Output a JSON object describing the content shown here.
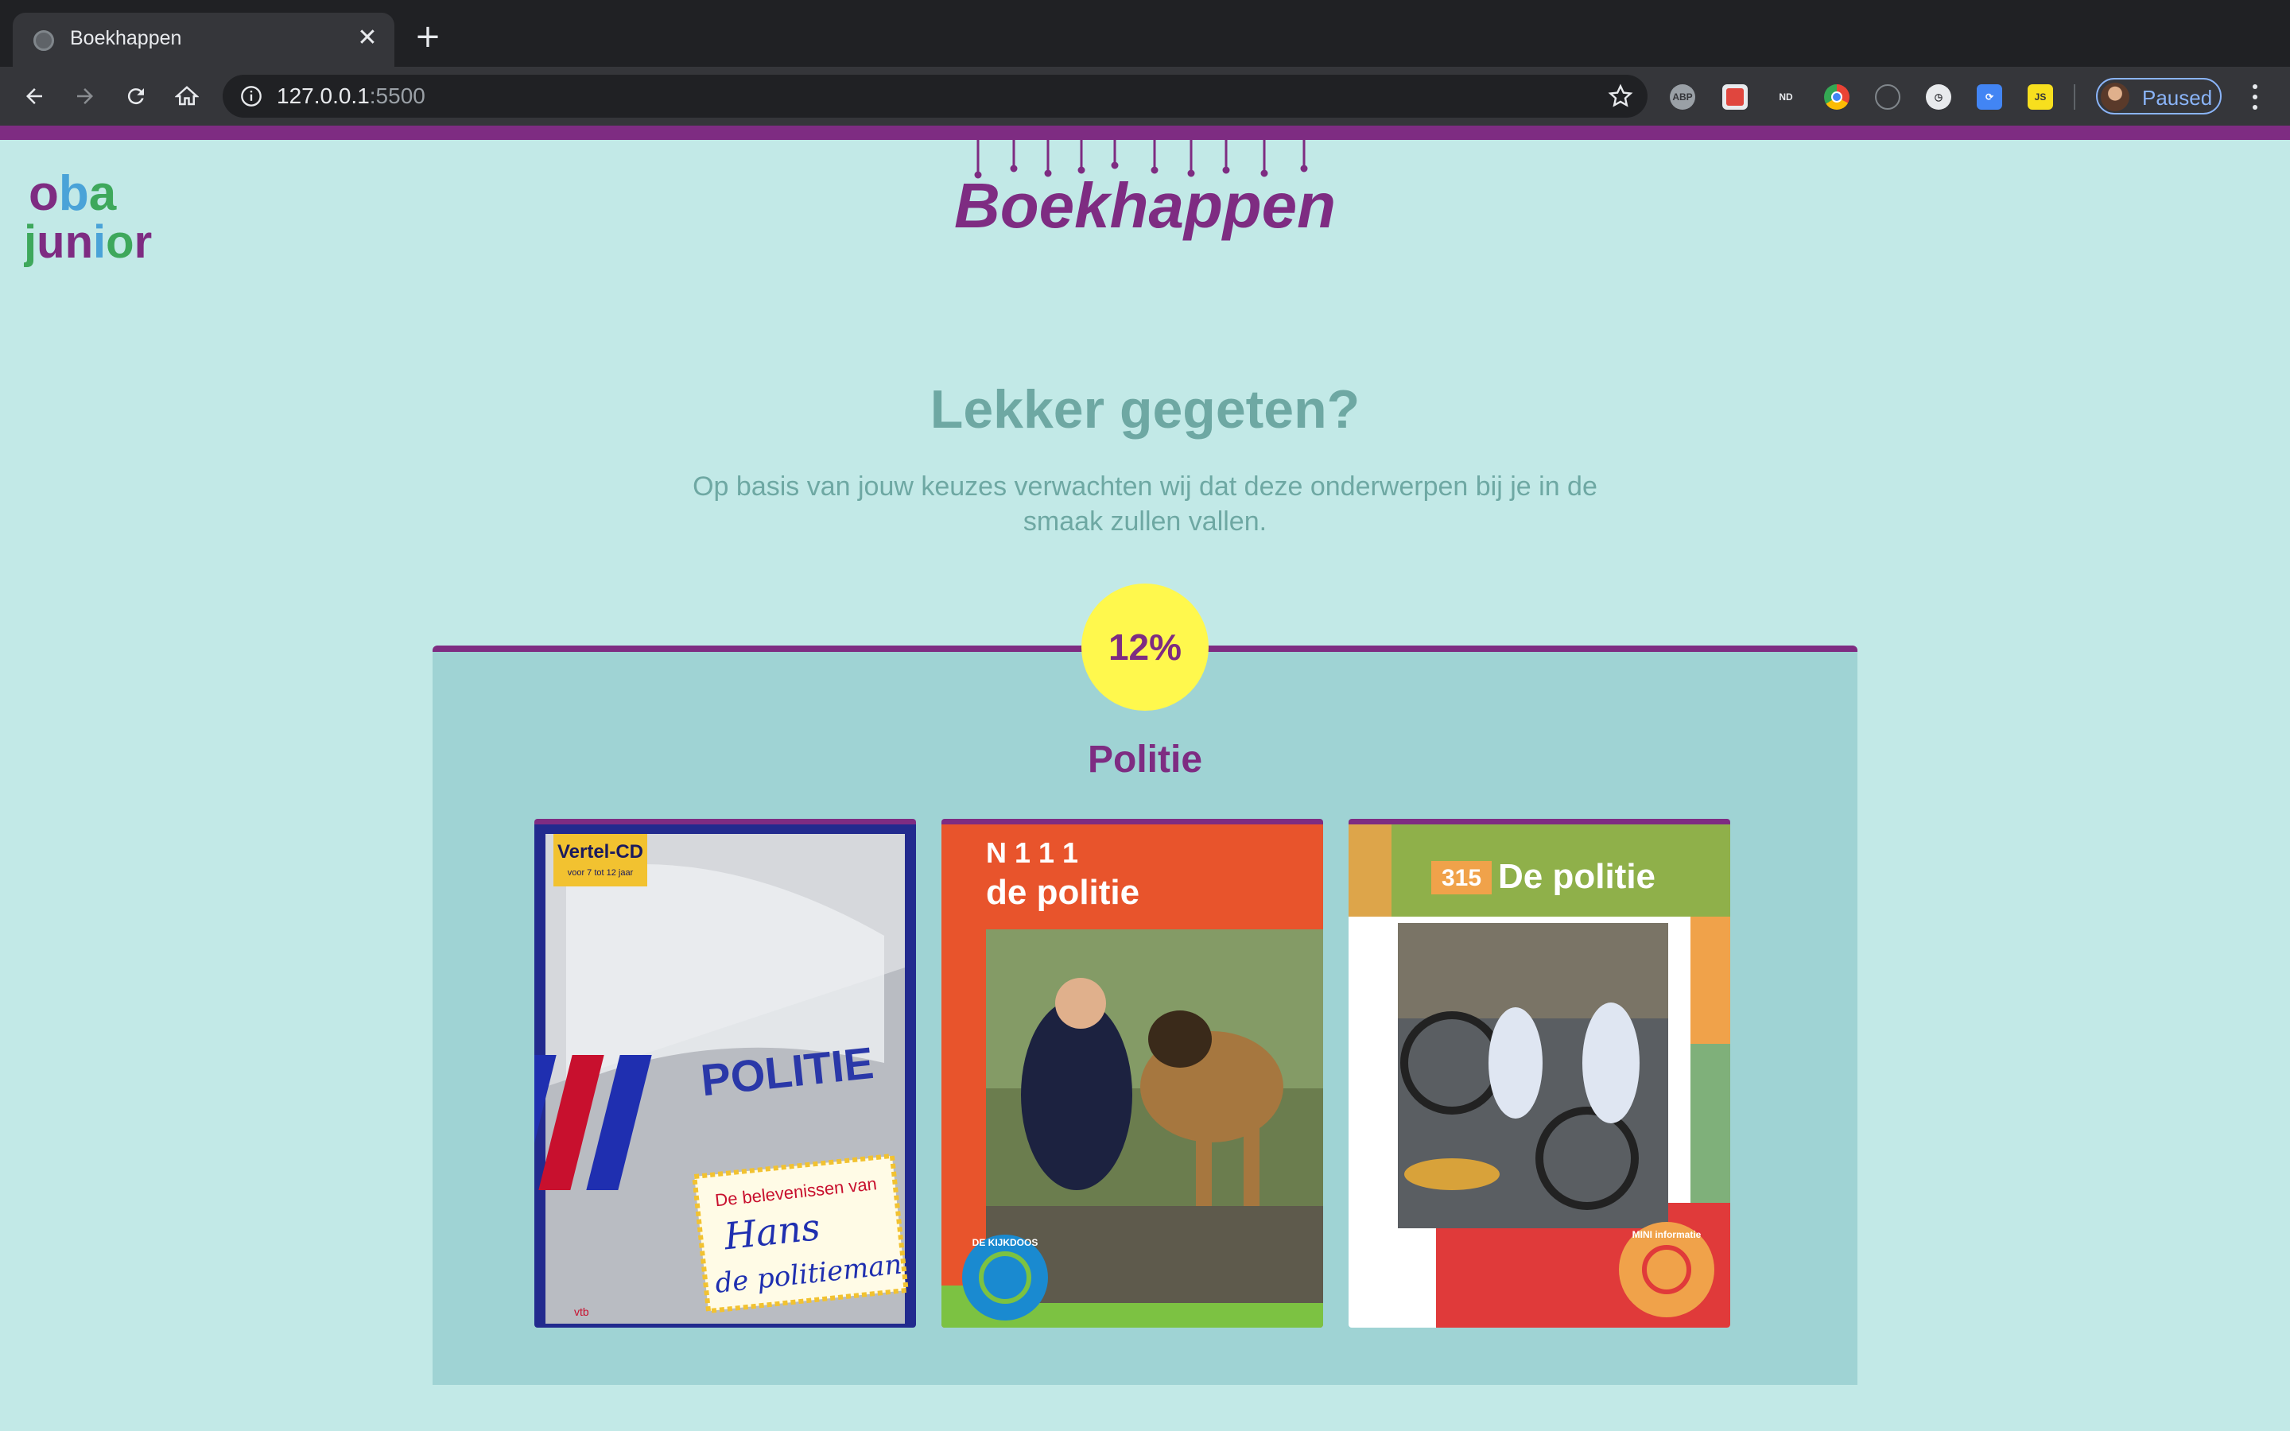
{
  "browser": {
    "tab_title": "Boekhappen",
    "tab_close": "✕",
    "new_tab": "+",
    "url_host": "127.0.0.1",
    "url_port": ":5500",
    "profile_label": "Paused",
    "extensions": [
      "ABP",
      "ND",
      "JS"
    ]
  },
  "logo": {
    "line1": "oba",
    "line2": "junior"
  },
  "brand": {
    "title": "Boekhappen"
  },
  "page": {
    "headline": "Lekker gegeten?",
    "subtext": "Op basis van jouw keuzes verwachten wij dat deze onderwerpen bij je in de smaak zullen vallen."
  },
  "result": {
    "percentage": "12%",
    "topic": "Politie",
    "books": [
      {
        "cover_sticker": "Vertel-CD",
        "cover_sticker_sub": "voor 7 tot 12 jaar",
        "cover_word": "POLITIE",
        "cover_title_1": "De belevenissen van",
        "cover_title_2": "Hans",
        "cover_title_3": "de politieman",
        "cover_publisher": "vtb"
      },
      {
        "cover_series": "N 1 1 1",
        "cover_title": "de politie",
        "cover_badge": "DE KIJKDOOS"
      },
      {
        "cover_number": "315",
        "cover_title": "De politie",
        "cover_badge": "MINI informatie"
      }
    ]
  },
  "colors": {
    "accent_purple": "#7e2c82",
    "badge_yellow": "#fff84d",
    "page_background": "#c2e9e7",
    "card_background": "#9fd3d4",
    "muted_teal_text": "#6ea8a3"
  }
}
